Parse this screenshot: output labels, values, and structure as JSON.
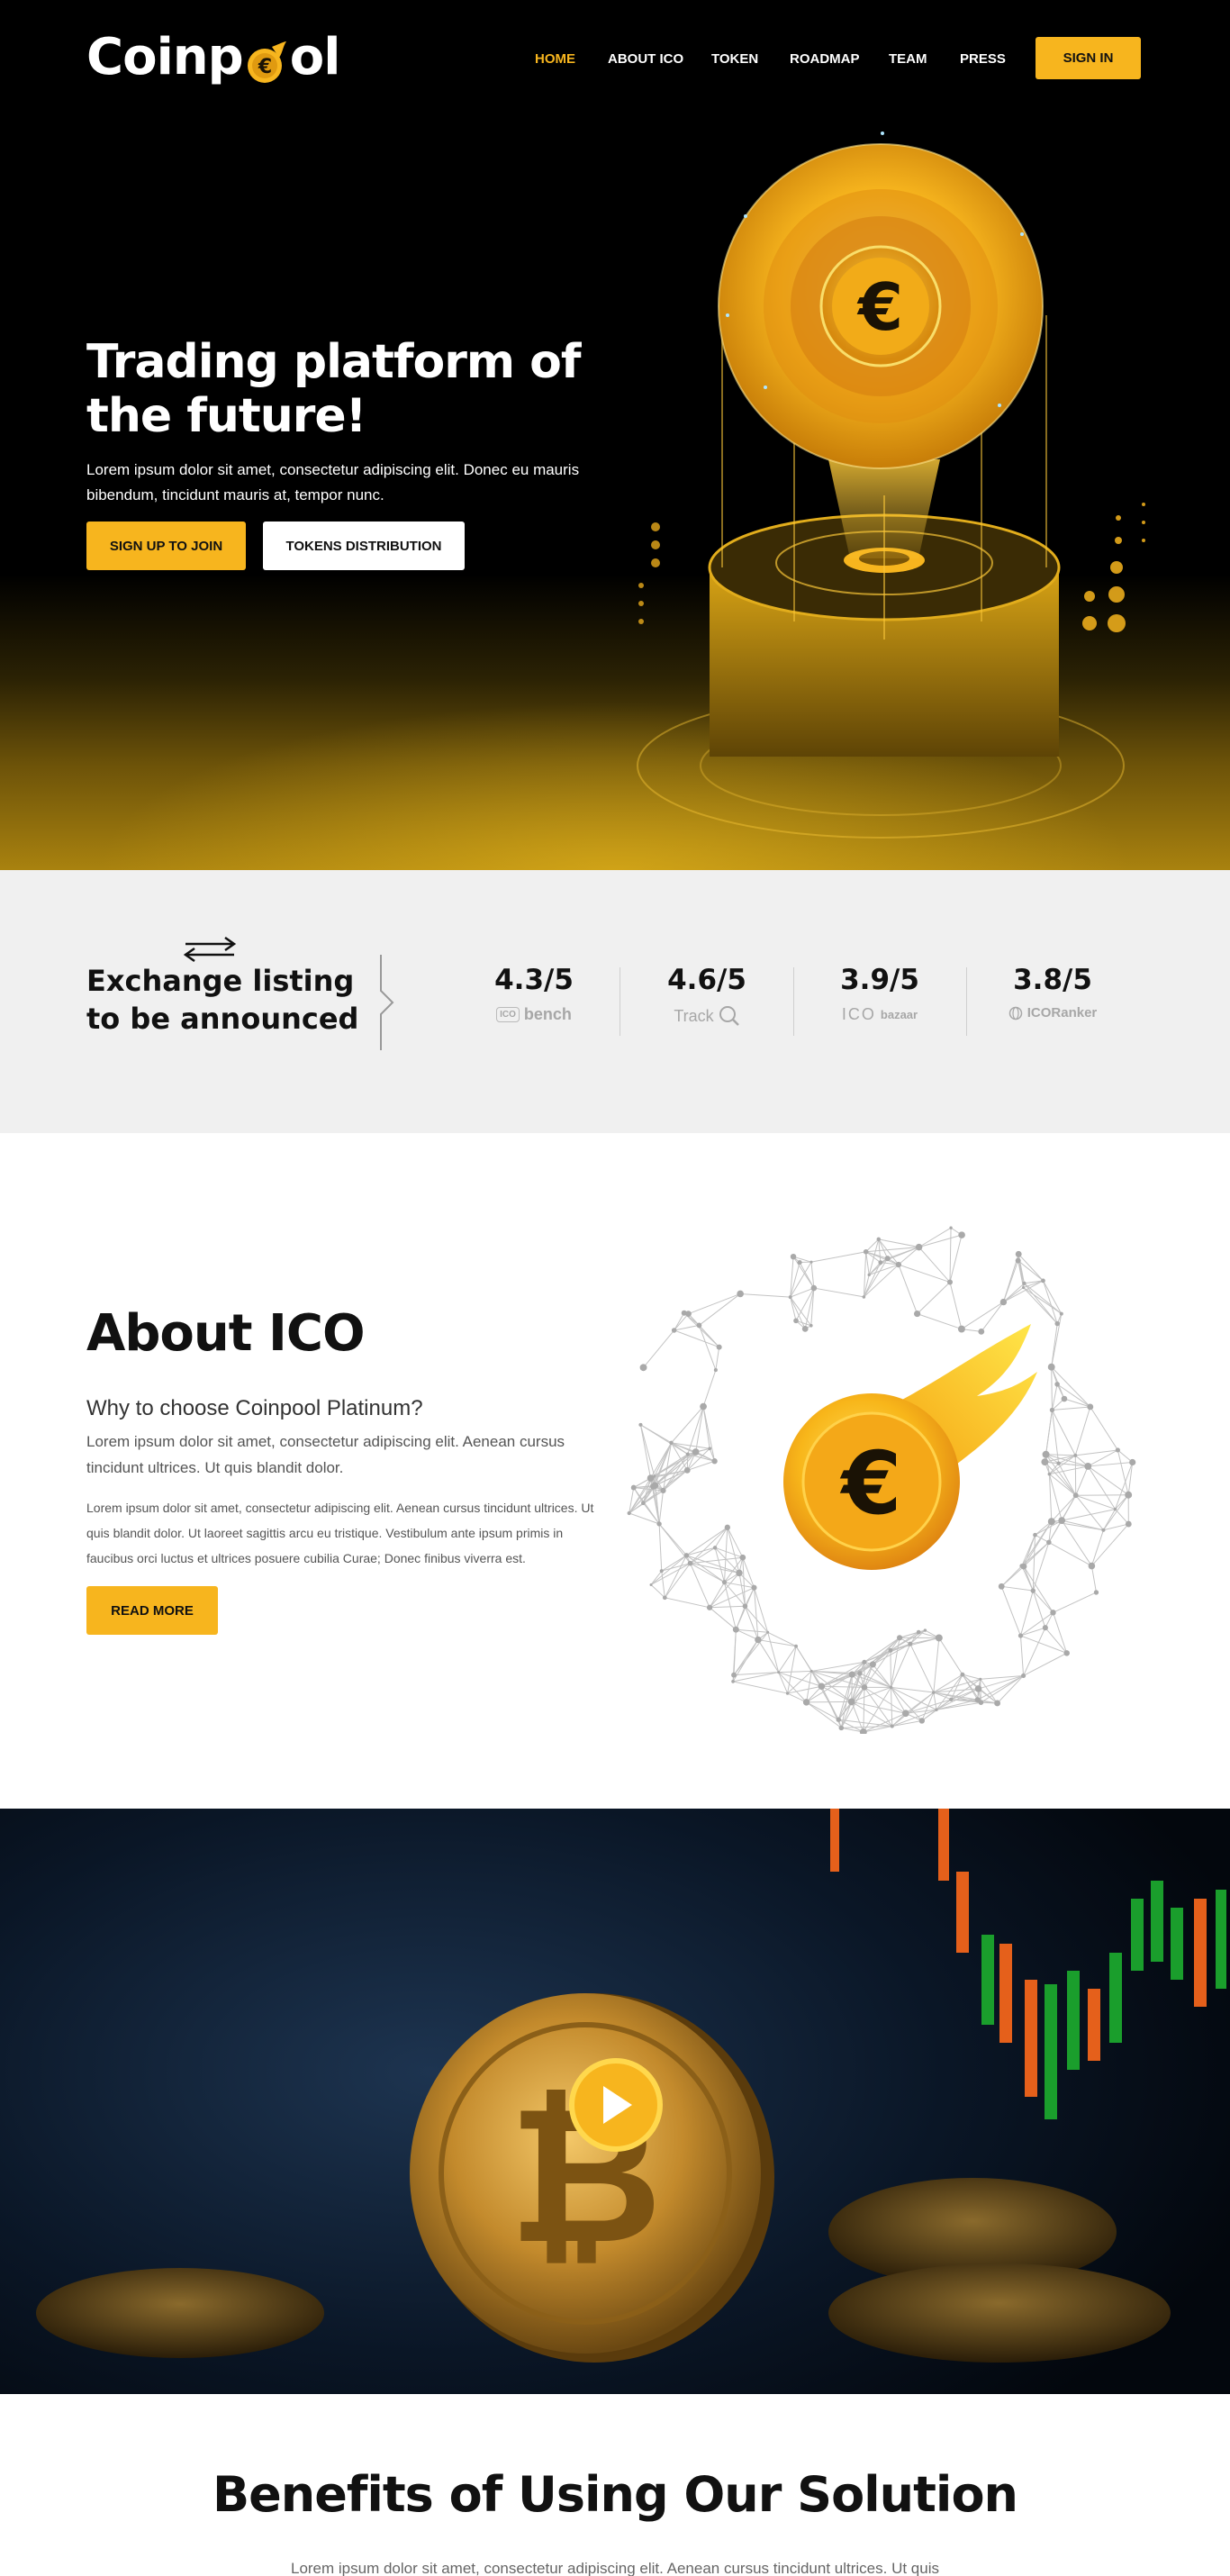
{
  "header": {
    "logo_text_left": "Coinp",
    "logo_text_right": "ol",
    "nav": [
      {
        "label": "HOME",
        "active": true
      },
      {
        "label": "ABOUT ICO",
        "active": false
      },
      {
        "label": "TOKEN",
        "active": false
      },
      {
        "label": "ROADMAP",
        "active": false
      },
      {
        "label": "TEAM",
        "active": false
      },
      {
        "label": "PRESS",
        "active": false
      }
    ],
    "signin_label": "SIGN IN"
  },
  "hero": {
    "title": "Trading platform of the future!",
    "subtitle": "Lorem ipsum dolor sit amet, consectetur adipiscing elit. Donec eu mauris bibendum, tincidunt mauris at, tempor nunc.",
    "primary_button": "SIGN UP TO JOIN",
    "secondary_button": "TOKENS DISTRIBUTION",
    "coin_symbol": "€"
  },
  "ratings": {
    "exchange_text": "Exchange listing to be announced",
    "items": [
      {
        "score": "4.3/5",
        "brand_prefix": "ICO",
        "brand_name": "bench"
      },
      {
        "score": "4.6/5",
        "brand_prefix": "",
        "brand_name": "Track"
      },
      {
        "score": "3.9/5",
        "brand_prefix": "ICO",
        "brand_name": "bazaar"
      },
      {
        "score": "3.8/5",
        "brand_prefix": "",
        "brand_name": "ICORanker"
      }
    ]
  },
  "about": {
    "title": "About ICO",
    "subtitle": "Why to choose Coinpool Platinum?",
    "lead": "Lorem ipsum dolor sit amet, consectetur adipiscing elit. Aenean cursus tincidunt ultrices. Ut quis blandit dolor.",
    "body": "Lorem ipsum dolor sit amet, consectetur adipiscing elit. Aenean cursus tincidunt ultrices. Ut quis blandit dolor. Ut laoreet sagittis arcu eu tristique. Vestibulum ante ipsum primis in faucibus orci luctus et ultrices posuere cubilia Curae; Donec finibus viverra est.",
    "button": "READ MORE",
    "coin_symbol": "€"
  },
  "video": {
    "play_icon": "play-icon"
  },
  "benefits": {
    "title": "Benefits of Using Our Solution",
    "text": "Lorem ipsum dolor sit amet, consectetur adipiscing elit. Aenean cursus tincidunt ultrices. Ut quis"
  },
  "colors": {
    "accent": "#f7b51e",
    "dark": "#000000",
    "strip_bg": "#f0f0f0"
  }
}
